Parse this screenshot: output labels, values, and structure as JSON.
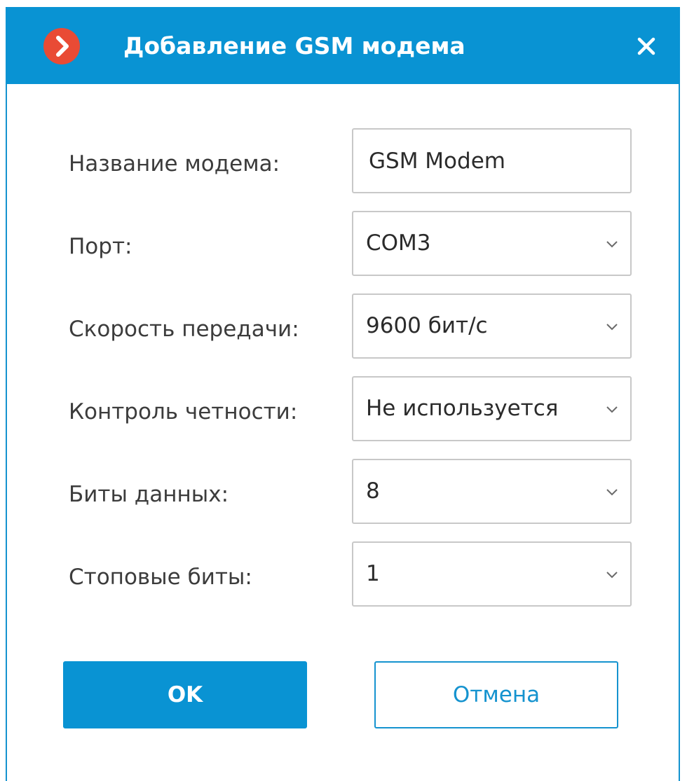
{
  "window": {
    "title": "Добавление GSM модема",
    "accent_color": "#0993d3",
    "app_icon": "chevron-right-circle-icon",
    "app_icon_color": "#e94b35",
    "close_icon": "close-icon"
  },
  "form": {
    "modem_name": {
      "label": "Название модема:",
      "value": "GSM Modem"
    },
    "port": {
      "label": "Порт:",
      "value": "COM3"
    },
    "baud_rate": {
      "label": "Скорость передачи:",
      "value": "9600 бит/с"
    },
    "parity": {
      "label": "Контроль четности:",
      "value": "Не используется"
    },
    "data_bits": {
      "label": "Биты данных:",
      "value": "8"
    },
    "stop_bits": {
      "label": "Стоповые биты:",
      "value": "1"
    }
  },
  "buttons": {
    "ok_label": "OK",
    "cancel_label": "Отмена"
  }
}
